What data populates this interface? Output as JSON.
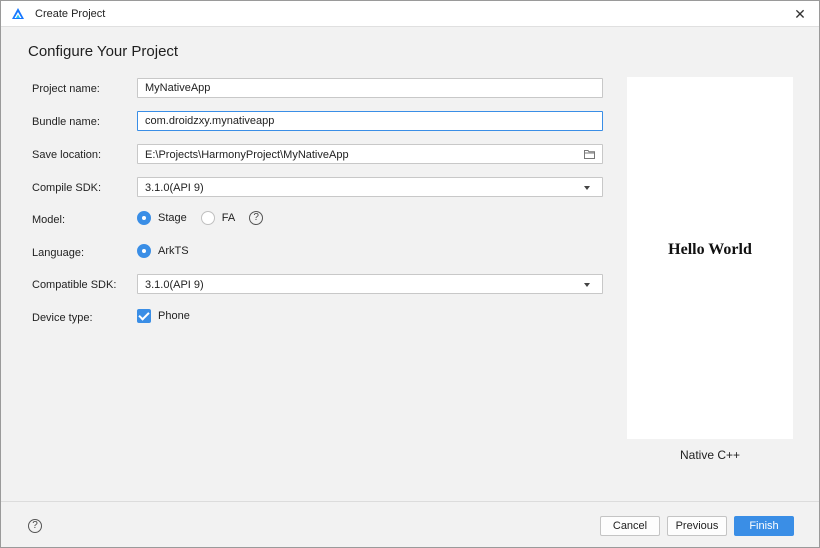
{
  "window": {
    "title": "Create Project",
    "close_glyph": "✕",
    "app_icon": "harmony-logo-icon"
  },
  "heading": "Configure Your Project",
  "form": {
    "project_name": {
      "label": "Project name:",
      "value": "MyNativeApp"
    },
    "bundle_name": {
      "label": "Bundle name:",
      "value": "com.droidzxy.mynativeapp"
    },
    "save_location": {
      "label": "Save location:",
      "value": "E:\\Projects\\HarmonyProject\\MyNativeApp",
      "icon": "folder-icon"
    },
    "compile_sdk": {
      "label": "Compile SDK:",
      "value": "3.1.0(API 9)"
    },
    "model": {
      "label": "Model:",
      "options": [
        {
          "label": "Stage",
          "selected": true
        },
        {
          "label": "FA",
          "selected": false
        }
      ],
      "help_glyph": "?"
    },
    "language": {
      "label": "Language:",
      "option": "ArkTS",
      "selected": true
    },
    "compatible_sdk": {
      "label": "Compatible SDK:",
      "value": "3.1.0(API 9)"
    },
    "device_type": {
      "label": "Device type:",
      "option": "Phone",
      "checked": true
    }
  },
  "preview": {
    "text": "Hello World",
    "template_name": "Native C++"
  },
  "footer": {
    "help_glyph": "?",
    "cancel": "Cancel",
    "previous": "Previous",
    "finish": "Finish"
  },
  "colors": {
    "accent": "#3a8ee6",
    "background": "#f2f2f2"
  }
}
